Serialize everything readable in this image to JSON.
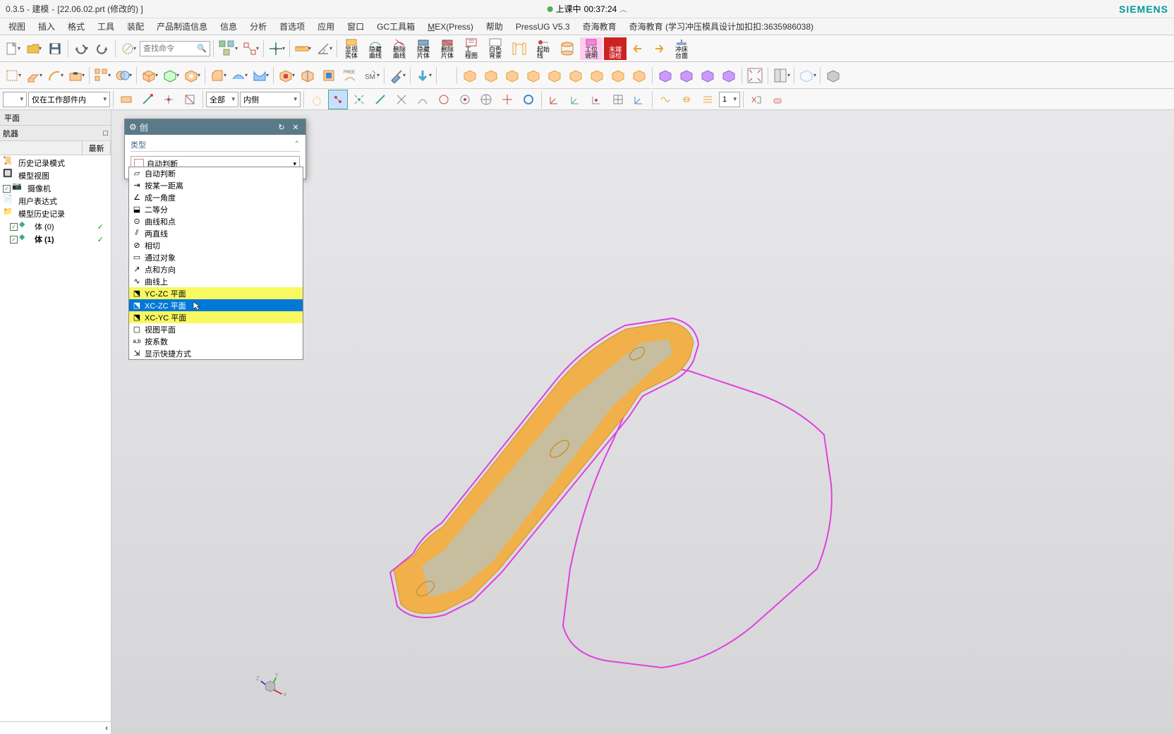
{
  "titlebar": {
    "app": "0.3.5 - 建模",
    "file": "[22.06.02.prt  (修改的) ]",
    "session_label": "上课中",
    "session_time": "00:37:24",
    "brand": "SIEMENS"
  },
  "menubar": {
    "items": [
      "视图",
      "插入",
      "格式",
      "工具",
      "装配",
      "产品制造信息",
      "信息",
      "分析",
      "首选项",
      "应用",
      "窗口",
      "GC工具箱",
      "MEX(Press)",
      "帮助",
      "PressUG V5.3",
      "奇海教育",
      "奇海教育  (学习冲压模具设计加扣扣:3635986038)"
    ]
  },
  "toolbar_search": {
    "placeholder": "查找命令"
  },
  "stacked_buttons": {
    "b1": "显视\n实体",
    "b2": "隐藏\n曲线",
    "b3": "删除\n曲线",
    "b4": "隐藏\n片体",
    "b5": "删除\n片体",
    "b6": "工\n程图",
    "b7": "白色\n背景",
    "b8": "起始\n线",
    "b9": "工位\n说明",
    "b10": "末端\n误检",
    "b11": "冲床\n台面"
  },
  "filter": {
    "scope": "仅在工作部件内",
    "all": "全部",
    "side": "内侧"
  },
  "left": {
    "panel_title": "平面",
    "nav_title": "航器",
    "pin_icon": "□",
    "tab_latest": "最新",
    "tree": {
      "history_mode": "历史记录模式",
      "model_view": "模型视图",
      "camera": "摄像机",
      "user_expr": "用户表达式",
      "model_history": "模型历史记录",
      "body0": "体 (0)",
      "body1": "体 (1)"
    }
  },
  "dialog": {
    "title": "创",
    "section_type": "类型",
    "current_type": "自动判断",
    "options": [
      "自动判断",
      "按某一距离",
      "成一角度",
      "二等分",
      "曲线和点",
      "两直线",
      "相切",
      "通过对象",
      "点和方向",
      "曲线上",
      "YC-ZC 平面",
      "XC-ZC 平面",
      "XC-YC 平面",
      "视图平面",
      "按系数",
      "显示快捷方式"
    ]
  },
  "triad": {
    "x": "X",
    "y": "Y",
    "z": "Z"
  }
}
